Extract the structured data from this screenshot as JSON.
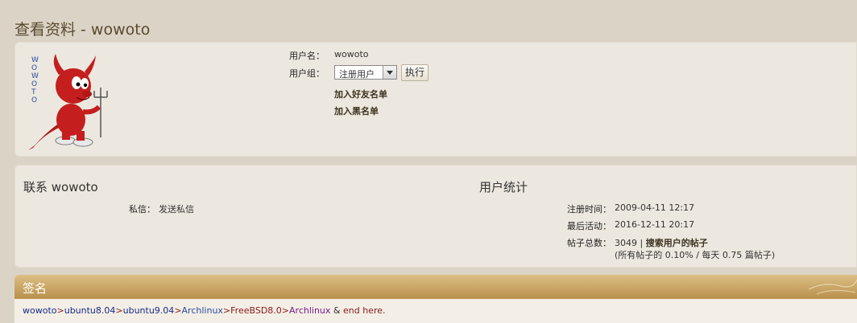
{
  "page": {
    "title": "查看资料 - wowoto"
  },
  "profile": {
    "avatar_vertical_text": [
      "W",
      "O",
      "W",
      "O",
      "T",
      "O"
    ],
    "username_label": "用户名：",
    "username": "wowoto",
    "group_label": "用户组：",
    "group_selected": "注册用户",
    "exec_button": "执行",
    "add_friend": "加入好友名单",
    "add_foe": "加入黑名单"
  },
  "contact": {
    "heading": "联系 wowoto",
    "pm_label": "私信：",
    "pm_link": "发送私信"
  },
  "stats": {
    "heading": "用户统计",
    "joined_label": "注册时间：",
    "joined_value": "2009-04-11 12:17",
    "last_active_label": "最后活动：",
    "last_active_value": "2016-12-11 20:17",
    "posts_label": "帖子总数：",
    "posts_count": "3049",
    "posts_separator": " | ",
    "search_posts_link": "搜索用户的帖子",
    "posts_detail": "(所有帖子的 0.10% / 每天 0.75 篇帖子)"
  },
  "signature": {
    "heading": "签名",
    "parts": [
      {
        "text": "wowoto",
        "color": "#1a2a8a"
      },
      {
        "text": ">",
        "color": "#8a1a1a"
      },
      {
        "text": "ubuntu8.04",
        "color": "#1a2a8a"
      },
      {
        "text": ">",
        "color": "#8a1a1a"
      },
      {
        "text": "ubuntu9.04",
        "color": "#1a2a8a"
      },
      {
        "text": ">",
        "color": "#8a1a1a"
      },
      {
        "text": "Archlinux",
        "color": "#2a4aa0"
      },
      {
        "text": ">",
        "color": "#8a1a1a"
      },
      {
        "text": "FreeBSD8.0",
        "color": "#8a1a1a"
      },
      {
        "text": ">",
        "color": "#8a1a1a"
      },
      {
        "text": "Archlinux",
        "color": "#7a1a8a"
      },
      {
        "text": " & ",
        "color": "#333333"
      },
      {
        "text": "end here.",
        "color": "#8a1a1a"
      }
    ]
  }
}
